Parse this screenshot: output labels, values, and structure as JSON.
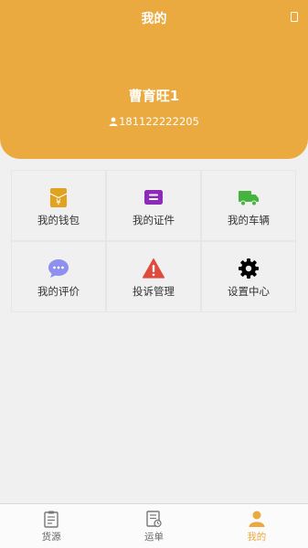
{
  "header": {
    "title": "我的",
    "user_name": "曹育旺1",
    "phone": "181122222205"
  },
  "menu": [
    {
      "label": "我的钱包",
      "icon": "wallet-icon",
      "color": "#e0a21f"
    },
    {
      "label": "我的证件",
      "icon": "id-card-icon",
      "color": "#8c2bb8"
    },
    {
      "label": "我的车辆",
      "icon": "truck-icon",
      "color": "#45b43f"
    },
    {
      "label": "我的评价",
      "icon": "chat-bubble-icon",
      "color": "#8f8ff0"
    },
    {
      "label": "投诉管理",
      "icon": "warning-icon",
      "color": "#e04a3f"
    },
    {
      "label": "设置中心",
      "icon": "gear-icon",
      "color": "#000000"
    }
  ],
  "tabs": [
    {
      "label": "货源",
      "icon": "clipboard-icon",
      "active": false
    },
    {
      "label": "运单",
      "icon": "waybill-icon",
      "active": false
    },
    {
      "label": "我的",
      "icon": "person-icon",
      "active": true
    }
  ],
  "colors": {
    "header": "#ebaa3f",
    "active_tab": "#ebaa3f"
  }
}
